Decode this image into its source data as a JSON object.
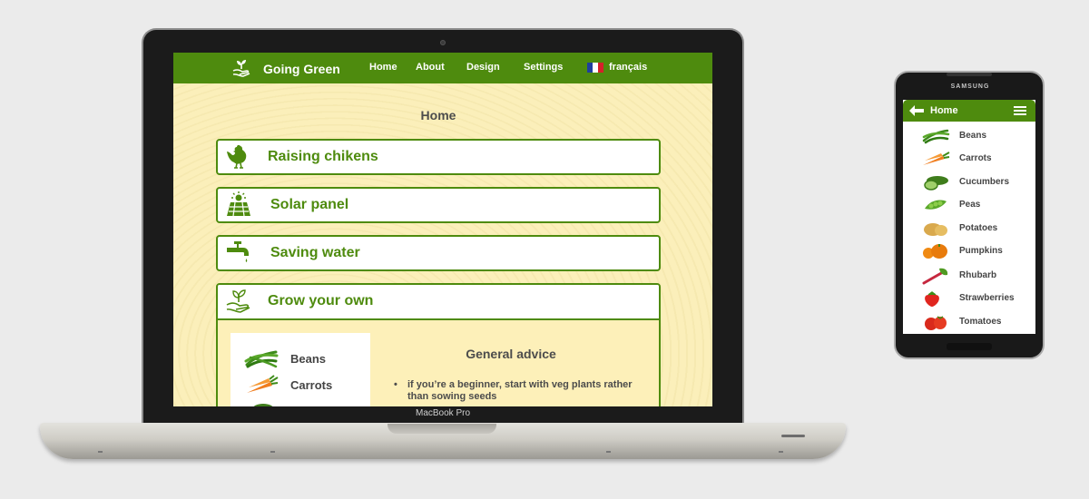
{
  "laptop": {
    "brand_label": "MacBook Pro",
    "nav": {
      "site_title": "Going Green",
      "links": [
        "Home",
        "About",
        "Design",
        "Settings"
      ],
      "language": "français"
    },
    "page_heading": "Home",
    "cards": [
      {
        "title": "Raising chikens",
        "icon": "chicken-icon"
      },
      {
        "title": "Solar panel",
        "icon": "solar-panel-icon"
      },
      {
        "title": "Saving water",
        "icon": "tap-icon"
      },
      {
        "title": "Grow your own",
        "icon": "seedling-hand-icon"
      }
    ],
    "grow_your_own": {
      "vegetables": [
        "Beans",
        "Carrots"
      ],
      "advice_title": "General advice",
      "advice": [
        "if you’re a beginner, start with veg plants rather than sowing seeds"
      ]
    }
  },
  "phone": {
    "brand_label": "SAMSUNG",
    "header_title": "Home",
    "items": [
      "Beans",
      "Carrots",
      "Cucumbers",
      "Peas",
      "Potatoes",
      "Pumpkins",
      "Rhubarb",
      "Strawberries",
      "Tomatoes"
    ]
  },
  "colors": {
    "brand_green": "#4e8b0e",
    "page_background": "#fbefba",
    "card_background": "#ffffff"
  }
}
